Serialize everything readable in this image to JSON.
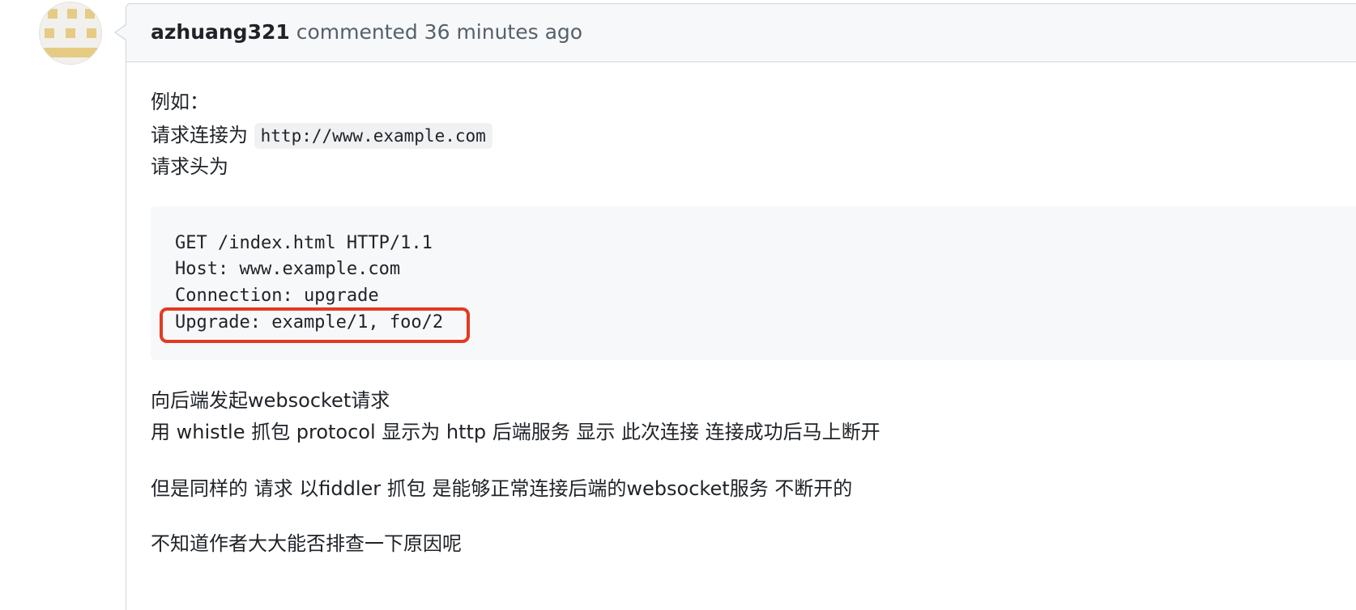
{
  "comment": {
    "author": "azhuang321",
    "action_text": " commented 36 minutes ago",
    "avatar_color": "#e6cb85",
    "body": {
      "line1": "例如：",
      "line2_prefix": "请求连接为 ",
      "line2_code": "http://www.example.com",
      "line3": "请求头为",
      "code_lines": [
        "GET /index.html HTTP/1.1",
        "Host: www.example.com",
        "Connection: upgrade",
        "Upgrade: example/1, foo/2"
      ],
      "para1_line1": "向后端发起websocket请求",
      "para1_line2": "用 whistle 抓包 protocol 显示为 http 后端服务 显示 此次连接 连接成功后马上断开",
      "para2": "但是同样的 请求 以fiddler 抓包 是能够正常连接后端的websocket服务 不断开的",
      "para3": "不知道作者大大能否排查一下原因呢"
    },
    "highlight_color": "#e23a22"
  }
}
